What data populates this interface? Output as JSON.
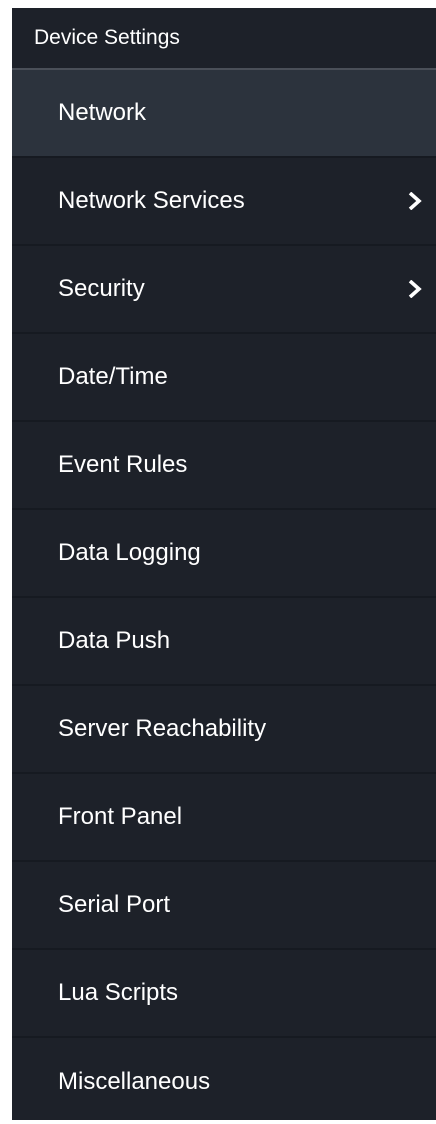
{
  "panel": {
    "header": "Device Settings",
    "items": [
      {
        "label": "Network",
        "active": true,
        "has_submenu": false
      },
      {
        "label": "Network Services",
        "active": false,
        "has_submenu": true,
        "icon": "chevron-right-icon"
      },
      {
        "label": "Security",
        "active": false,
        "has_submenu": true,
        "icon": "chevron-right-icon"
      },
      {
        "label": "Date/Time",
        "active": false,
        "has_submenu": false
      },
      {
        "label": "Event Rules",
        "active": false,
        "has_submenu": false
      },
      {
        "label": "Data Logging",
        "active": false,
        "has_submenu": false
      },
      {
        "label": "Data Push",
        "active": false,
        "has_submenu": false
      },
      {
        "label": "Server Reachability",
        "active": false,
        "has_submenu": false
      },
      {
        "label": "Front Panel",
        "active": false,
        "has_submenu": false
      },
      {
        "label": "Serial Port",
        "active": false,
        "has_submenu": false
      },
      {
        "label": "Lua Scripts",
        "active": false,
        "has_submenu": false
      },
      {
        "label": "Miscellaneous",
        "active": false,
        "has_submenu": false
      }
    ]
  },
  "colors": {
    "panel_bg": "#1d2129",
    "active_bg": "#2c333d",
    "text": "#ffffff",
    "header_divider": "#4a4f58"
  }
}
